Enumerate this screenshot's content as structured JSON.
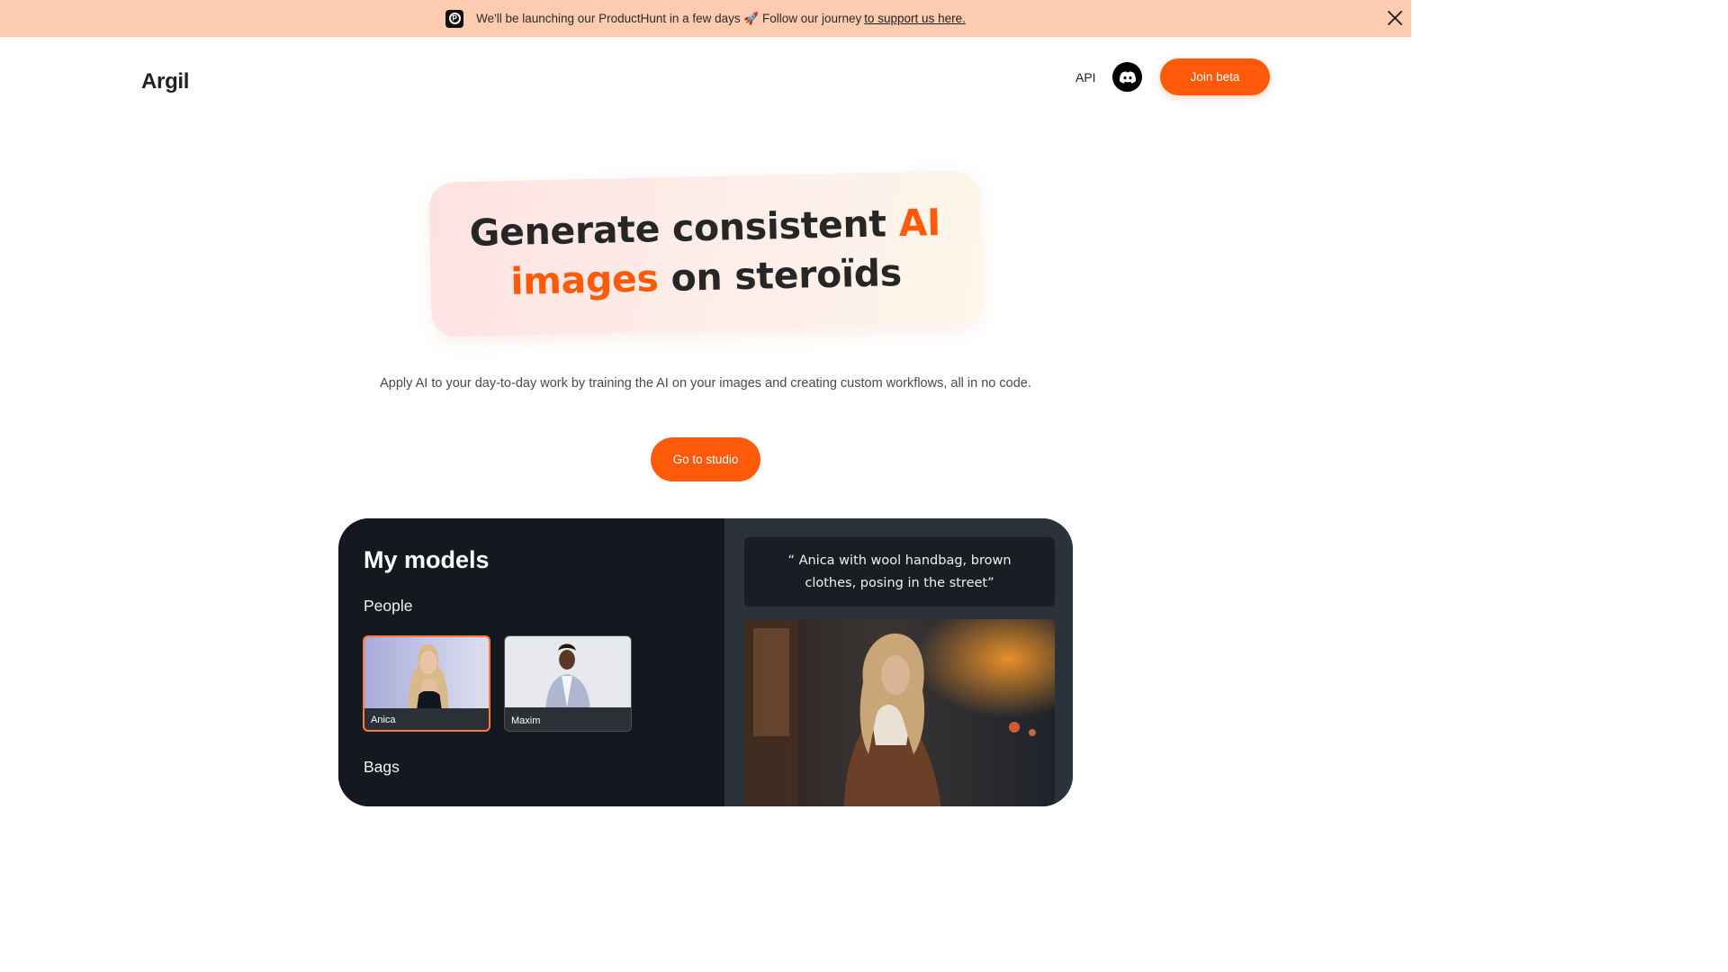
{
  "banner": {
    "text": "We'll be launching our ProductHunt in a few days 🚀 Follow our journey",
    "link_text": "to support us here."
  },
  "header": {
    "logo": "Argil",
    "api_label": "API",
    "join_label": "Join beta"
  },
  "hero": {
    "title_part1": "Generate consistent",
    "title_accent1": "AI",
    "title_accent2": "images",
    "title_part2": "on steroïds",
    "subtitle": "Apply AI to your day-to-day work by training the AI on your images and creating custom workflows, all in no code.",
    "cta_label": "Go to studio"
  },
  "models_panel": {
    "title": "My models",
    "sections": {
      "people": "People",
      "bags": "Bags"
    },
    "people": [
      {
        "name": "Anica",
        "selected": true
      },
      {
        "name": "Maxim",
        "selected": false
      }
    ],
    "prompt": "“ Anica with wool handbag, brown clothes, posing in the street”"
  },
  "colors": {
    "accent": "#ff5a0a",
    "banner_bg": "#fdcbb0",
    "panel_dark": "#15191f",
    "panel_right": "#2c3239"
  },
  "icons": {
    "banner_logo": "producthunt-logo-icon",
    "close": "close-icon",
    "discord": "discord-icon"
  }
}
